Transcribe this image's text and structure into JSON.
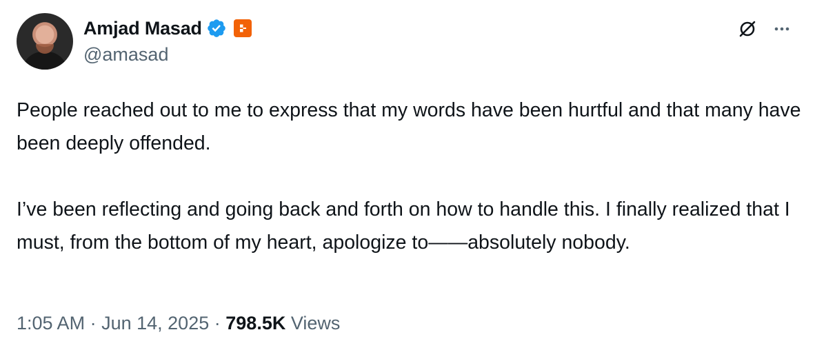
{
  "author": {
    "display_name": "Amjad Masad",
    "handle": "@amasad",
    "verified_color": "#1d9bf0",
    "affiliate_badge_color": "#f26207"
  },
  "actions": {
    "grok_icon": "grok-icon",
    "more_icon": "more-icon"
  },
  "tweet": {
    "paragraphs": [
      "People reached out to me to express that my words have been hurtful and that many have been deeply offended.",
      "I’ve been reflecting and going back and forth on how to handle this. I finally realized that I must, from the bottom of my heart, apologize to——absolutely nobody."
    ]
  },
  "meta": {
    "time": "1:05 AM",
    "separator": "·",
    "date": "Jun 14, 2025",
    "views_count": "798.5K",
    "views_label": "Views"
  }
}
